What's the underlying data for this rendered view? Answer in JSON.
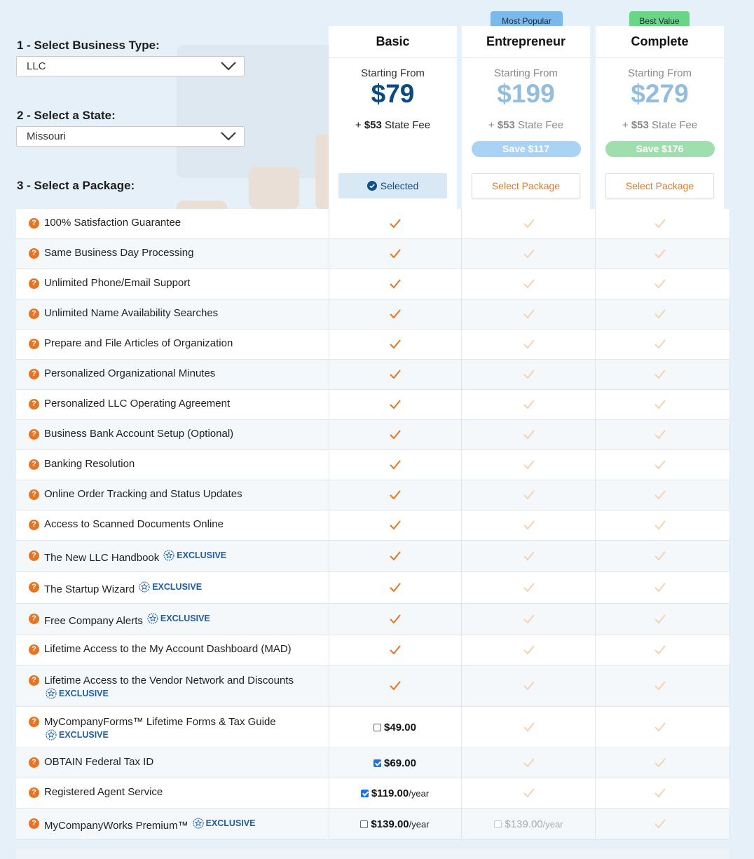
{
  "form": {
    "step1_label": "1 - Select Business Type:",
    "step1_value": "LLC",
    "step2_label": "2 - Select a State:",
    "step2_value": "Missouri",
    "step3_label": "3 - Select a Package:"
  },
  "plans": [
    {
      "name": "Basic",
      "starting": "Starting From",
      "price": "$79",
      "fee_prefix": "+ ",
      "fee_amount": "$53",
      "fee_suffix": " State Fee",
      "button": "Selected",
      "selected": true
    },
    {
      "name": "Entrepreneur",
      "starting": "Starting From",
      "price": "$199",
      "fee_prefix": "+ ",
      "fee_amount": "$53",
      "fee_suffix": " State Fee",
      "save": "Save $117",
      "badge": "Most Popular",
      "button": "Select Package"
    },
    {
      "name": "Complete",
      "starting": "Starting From",
      "price": "$279",
      "fee_prefix": "+ ",
      "fee_amount": "$53",
      "fee_suffix": " State Fee",
      "save": "Save $176",
      "badge": "Best Value",
      "button": "Select Package"
    }
  ],
  "colors": {
    "accent_orange": "#e9731f",
    "price_blue": "#0a4a85",
    "price_muted": "#93bddf",
    "save_blue": "#a9d3f5",
    "save_green": "#9fdfae",
    "badge_blue": "#7ab9ea",
    "badge_green": "#69d586",
    "exclusive_blue": "#1e5e9f"
  },
  "exclusive_label": "EXCLUSIVE",
  "features": [
    {
      "text": "100% Satisfaction Guarantee"
    },
    {
      "text": "Same Business Day Processing"
    },
    {
      "text": "Unlimited Phone/Email Support"
    },
    {
      "text": "Unlimited Name Availability Searches"
    },
    {
      "text": "Prepare and File Articles of Organization"
    },
    {
      "text": "Personalized Organizational Minutes"
    },
    {
      "text": "Personalized LLC Operating Agreement"
    },
    {
      "text": "Business Bank Account Setup (Optional)"
    },
    {
      "text": "Banking Resolution"
    },
    {
      "text": "Online Order Tracking and Status Updates"
    },
    {
      "text": "Access to Scanned Documents Online"
    },
    {
      "text": "The New LLC Handbook",
      "exclusive": true
    },
    {
      "text": "The Startup Wizard",
      "exclusive": true
    },
    {
      "text": "Free Company Alerts",
      "exclusive": true
    },
    {
      "text": "Lifetime Access to the My Account Dashboard (MAD)"
    },
    {
      "text": "Lifetime Access to the Vendor Network and Discounts",
      "exclusive": true,
      "wrap": true
    },
    {
      "text": "MyCompanyForms™ Lifetime Forms & Tax Guide",
      "exclusive": true,
      "wrap": true,
      "basic": {
        "checked": false,
        "price": "$49.00",
        "unit": ""
      }
    },
    {
      "text": "OBTAIN Federal Tax ID",
      "basic": {
        "checked": true,
        "price": "$69.00",
        "unit": ""
      }
    },
    {
      "text": "Registered Agent Service",
      "basic": {
        "checked": true,
        "price": "$119.00",
        "unit": "/year"
      }
    },
    {
      "text": "MyCompanyWorks Premium™",
      "exclusive": true,
      "basic": {
        "checked": false,
        "price": "$139.00",
        "unit": "/year"
      },
      "entrepreneur": {
        "checked": false,
        "price": "$139.00",
        "unit": "/year"
      }
    }
  ]
}
